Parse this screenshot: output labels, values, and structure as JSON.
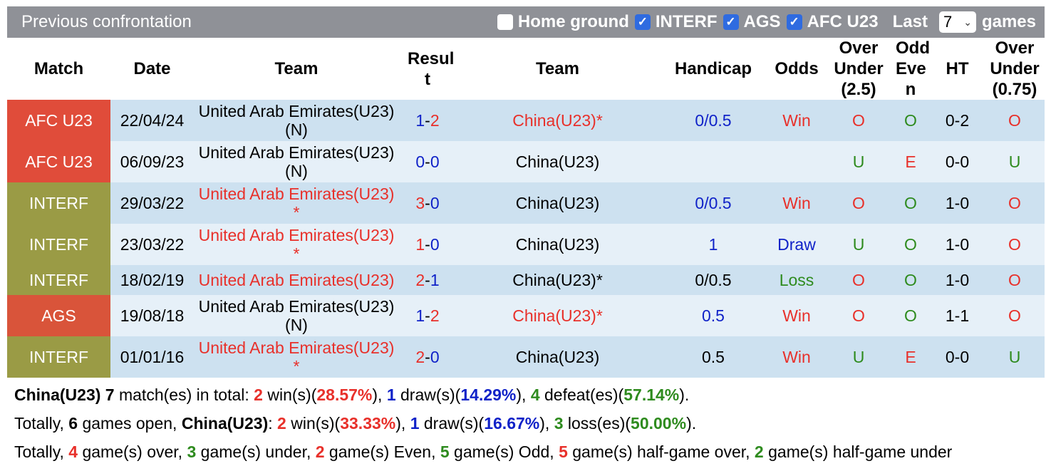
{
  "header": {
    "title": "Previous confrontation",
    "filters": [
      {
        "label": "Home ground",
        "checked": false
      },
      {
        "label": "INTERF",
        "checked": true
      },
      {
        "label": "AGS",
        "checked": true
      },
      {
        "label": "AFC U23",
        "checked": true
      }
    ],
    "last_label": "Last",
    "games_count": "7",
    "games_label": "games"
  },
  "columns": [
    "Match",
    "Date",
    "Team",
    "Resul t",
    "Team",
    "Handicap",
    "Odds",
    "Over Under (2.5)",
    "Odd Eve n",
    "HT",
    "Over Under (0.75)"
  ],
  "league_colors": {
    "AFC U23": "#e04c3a",
    "INTERF": "#9a9b45",
    "AGS": "#d9543a"
  },
  "rows": [
    {
      "league": "AFC U23",
      "date": "22/04/24",
      "home": "United Arab Emirates(U23)",
      "home_suffix": "(N)",
      "home_color": "blk",
      "home_goals": "1",
      "home_goals_color": "blue",
      "away_goals": "2",
      "away_goals_color": "red",
      "away": "China(U23)*",
      "away_color": "red",
      "handicap": "0/0.5",
      "handicap_color": "blue",
      "odds": "Win",
      "odds_color": "red",
      "ou": "O",
      "ou_color": "red",
      "oe": "O",
      "oe_color": "green",
      "ht": "0-2",
      "ou2": "O",
      "ou2_color": "red"
    },
    {
      "league": "AFC U23",
      "date": "06/09/23",
      "home": "United Arab Emirates(U23)",
      "home_suffix": "(N)",
      "home_color": "blk",
      "home_goals": "0",
      "home_goals_color": "blue",
      "away_goals": "0",
      "away_goals_color": "blue",
      "away": "China(U23)",
      "away_color": "blk",
      "handicap": "",
      "handicap_color": "blue",
      "odds": "",
      "odds_color": "red",
      "ou": "U",
      "ou_color": "green",
      "oe": "E",
      "oe_color": "red",
      "ht": "0-0",
      "ou2": "U",
      "ou2_color": "green"
    },
    {
      "league": "INTERF",
      "date": "29/03/22",
      "home": "United Arab Emirates(U23)",
      "home_suffix": "*",
      "home_color": "red",
      "home_goals": "3",
      "home_goals_color": "red",
      "away_goals": "0",
      "away_goals_color": "blue",
      "away": "China(U23)",
      "away_color": "blk",
      "handicap": "0/0.5",
      "handicap_color": "blue",
      "odds": "Win",
      "odds_color": "red",
      "ou": "O",
      "ou_color": "red",
      "oe": "O",
      "oe_color": "green",
      "ht": "1-0",
      "ou2": "O",
      "ou2_color": "red"
    },
    {
      "league": "INTERF",
      "date": "23/03/22",
      "home": "United Arab Emirates(U23)",
      "home_suffix": "*",
      "home_color": "red",
      "home_goals": "1",
      "home_goals_color": "red",
      "away_goals": "0",
      "away_goals_color": "blue",
      "away": "China(U23)",
      "away_color": "blk",
      "handicap": "1",
      "handicap_color": "blue",
      "odds": "Draw",
      "odds_color": "blue",
      "ou": "U",
      "ou_color": "green",
      "oe": "O",
      "oe_color": "green",
      "ht": "1-0",
      "ou2": "O",
      "ou2_color": "red"
    },
    {
      "league": "INTERF",
      "date": "18/02/19",
      "home": "United Arab Emirates(U23)",
      "home_suffix": "",
      "home_color": "red",
      "home_goals": "2",
      "home_goals_color": "red",
      "away_goals": "1",
      "away_goals_color": "blue",
      "away": "China(U23)*",
      "away_color": "blk",
      "handicap": "0/0.5",
      "handicap_color": "blk",
      "odds": "Loss",
      "odds_color": "green",
      "ou": "O",
      "ou_color": "red",
      "oe": "O",
      "oe_color": "green",
      "ht": "1-0",
      "ou2": "O",
      "ou2_color": "red"
    },
    {
      "league": "AGS",
      "date": "19/08/18",
      "home": "United Arab Emirates(U23)",
      "home_suffix": "(N)",
      "home_color": "blk",
      "home_goals": "1",
      "home_goals_color": "blue",
      "away_goals": "2",
      "away_goals_color": "red",
      "away": "China(U23)*",
      "away_color": "red",
      "handicap": "0.5",
      "handicap_color": "blue",
      "odds": "Win",
      "odds_color": "red",
      "ou": "O",
      "ou_color": "red",
      "oe": "O",
      "oe_color": "green",
      "ht": "1-1",
      "ou2": "O",
      "ou2_color": "red"
    },
    {
      "league": "INTERF",
      "date": "01/01/16",
      "home": "United Arab Emirates(U23)",
      "home_suffix": "*",
      "home_color": "red",
      "home_goals": "2",
      "home_goals_color": "red",
      "away_goals": "0",
      "away_goals_color": "blue",
      "away": "China(U23)",
      "away_color": "blk",
      "handicap": "0.5",
      "handicap_color": "blk",
      "odds": "Win",
      "odds_color": "red",
      "ou": "U",
      "ou_color": "green",
      "oe": "E",
      "oe_color": "red",
      "ht": "0-0",
      "ou2": "U",
      "ou2_color": "green"
    }
  ],
  "summary": [
    [
      {
        "t": "China(U23)",
        "s": "b"
      },
      {
        "t": " "
      },
      {
        "t": "7",
        "s": "b"
      },
      {
        "t": " match(es) in total: "
      },
      {
        "t": "2",
        "s": "bred"
      },
      {
        "t": " win(s)("
      },
      {
        "t": "28.57%",
        "s": "bred"
      },
      {
        "t": "), "
      },
      {
        "t": "1",
        "s": "bblue"
      },
      {
        "t": " draw(s)("
      },
      {
        "t": "14.29%",
        "s": "bblue"
      },
      {
        "t": "), "
      },
      {
        "t": "4",
        "s": "bgreen"
      },
      {
        "t": " defeat(es)("
      },
      {
        "t": "57.14%",
        "s": "bgreen"
      },
      {
        "t": ")."
      }
    ],
    [
      {
        "t": "Totally, "
      },
      {
        "t": "6",
        "s": "b"
      },
      {
        "t": " games open, "
      },
      {
        "t": "China(U23)",
        "s": "b"
      },
      {
        "t": ": "
      },
      {
        "t": "2",
        "s": "bred"
      },
      {
        "t": " win(s)("
      },
      {
        "t": "33.33%",
        "s": "bred"
      },
      {
        "t": "), "
      },
      {
        "t": "1",
        "s": "bblue"
      },
      {
        "t": " draw(s)("
      },
      {
        "t": "16.67%",
        "s": "bblue"
      },
      {
        "t": "), "
      },
      {
        "t": "3",
        "s": "bgreen"
      },
      {
        "t": " loss(es)("
      },
      {
        "t": "50.00%",
        "s": "bgreen"
      },
      {
        "t": ")."
      }
    ],
    [
      {
        "t": "Totally, "
      },
      {
        "t": "4",
        "s": "bred"
      },
      {
        "t": " game(s) over, "
      },
      {
        "t": "3",
        "s": "bgreen"
      },
      {
        "t": " game(s) under, "
      },
      {
        "t": "2",
        "s": "bred"
      },
      {
        "t": " game(s) Even, "
      },
      {
        "t": "5",
        "s": "bgreen"
      },
      {
        "t": " game(s) Odd, "
      },
      {
        "t": "5",
        "s": "bred"
      },
      {
        "t": " game(s) half-game over, "
      },
      {
        "t": "2",
        "s": "bgreen"
      },
      {
        "t": " game(s) half-game under"
      }
    ]
  ]
}
